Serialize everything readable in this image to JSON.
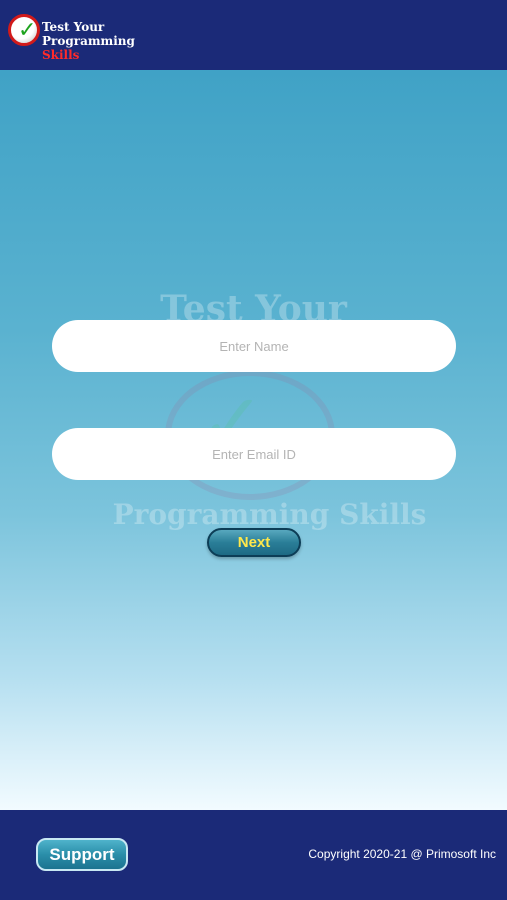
{
  "header": {
    "logo": {
      "line1": "Test Your",
      "line2_part1": "Programming ",
      "line2_part2": "Skills"
    }
  },
  "watermark": {
    "top_text": "Test Your",
    "bottom_text": "Programming Skills"
  },
  "form": {
    "name_placeholder": "Enter Name",
    "email_placeholder": "Enter Email ID",
    "name_value": "",
    "email_value": "",
    "next_label": "Next"
  },
  "footer": {
    "support_label": "Support",
    "copyright": "Copyright 2020-21 @ Primosoft Inc"
  },
  "colors": {
    "header_bg": "#1b2a78",
    "footer_bg": "#1b2a78",
    "next_text": "#ffe84a",
    "logo_skills": "#ff2a2a"
  },
  "icons": {
    "logo_badge": "check-mark-icon"
  }
}
